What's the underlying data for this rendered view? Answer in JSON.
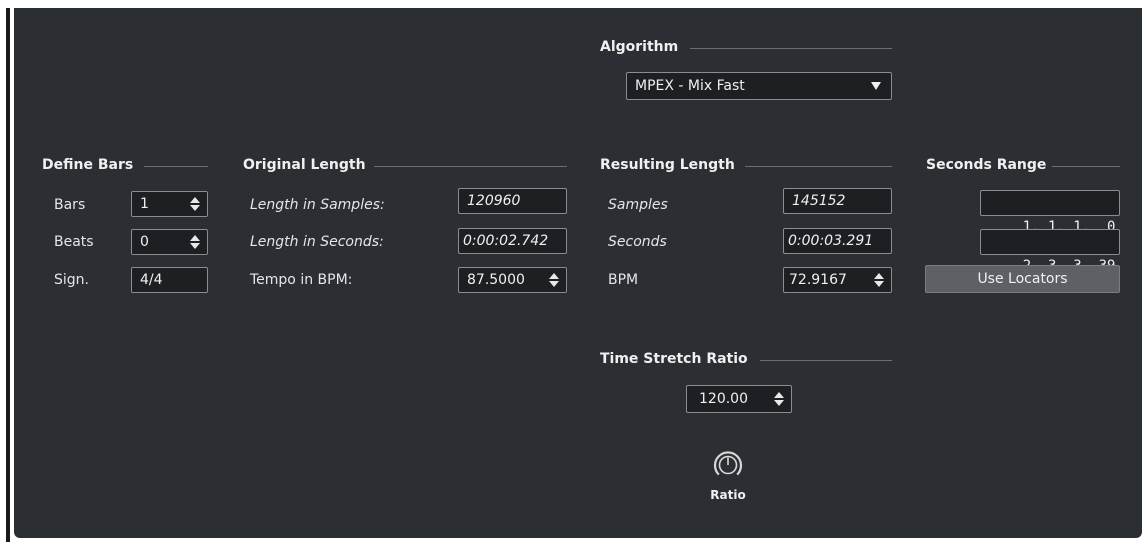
{
  "algorithm": {
    "heading": "Algorithm",
    "selected": "MPEX - Mix Fast"
  },
  "define_bars": {
    "heading": "Define Bars",
    "bars_label": "Bars",
    "bars_value": "1",
    "beats_label": "Beats",
    "beats_value": "0",
    "sign_label": "Sign.",
    "sign_value": "4/4"
  },
  "original_length": {
    "heading": "Original Length",
    "samples_label": "Length in Samples:",
    "samples_value": "120960",
    "seconds_label": "Length in Seconds:",
    "seconds_value": "0:00:02.742",
    "tempo_label": "Tempo in BPM:",
    "tempo_value": "87.5000"
  },
  "resulting_length": {
    "heading": "Resulting Length",
    "samples_label": "Samples",
    "samples_value": "145152",
    "seconds_label": "Seconds",
    "seconds_value": "0:00:03.291",
    "bpm_label": "BPM",
    "bpm_value": "72.9167"
  },
  "seconds_range": {
    "heading": "Seconds Range",
    "start": "1. 1. 1.  0",
    "end": "2. 3. 3. 39",
    "use_locators": "Use Locators"
  },
  "time_stretch": {
    "heading": "Time Stretch Ratio",
    "value": "120.00",
    "knob_label": "Ratio",
    "knob_icon": "ratio-knob-icon"
  },
  "colors": {
    "panel": "#2b2e32",
    "field_bg": "#1d1f22",
    "button_bg": "#5d6064"
  }
}
